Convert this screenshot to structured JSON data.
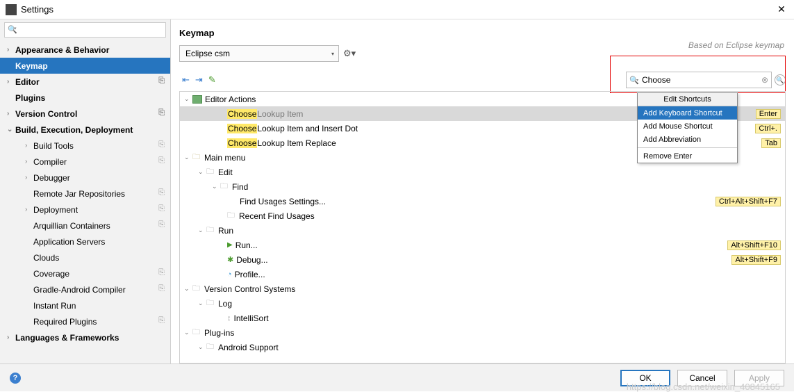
{
  "window": {
    "title": "Settings"
  },
  "sidebar_search": {
    "placeholder": ""
  },
  "sidebar": {
    "items": [
      {
        "label": "Appearance & Behavior",
        "bold": true,
        "chev": "›",
        "indent": 0
      },
      {
        "label": "Keymap",
        "bold": true,
        "selected": true,
        "indent": 0
      },
      {
        "label": "Editor",
        "bold": true,
        "chev": "›",
        "copy": true,
        "indent": 0
      },
      {
        "label": "Plugins",
        "bold": true,
        "indent": 0
      },
      {
        "label": "Version Control",
        "bold": true,
        "chev": "›",
        "copy": true,
        "indent": 0
      },
      {
        "label": "Build, Execution, Deployment",
        "bold": true,
        "chev": "⌄",
        "indent": 0
      },
      {
        "label": "Build Tools",
        "chev": "›",
        "copy": true,
        "indent": 1
      },
      {
        "label": "Compiler",
        "chev": "›",
        "copy": true,
        "indent": 1
      },
      {
        "label": "Debugger",
        "chev": "›",
        "indent": 1
      },
      {
        "label": "Remote Jar Repositories",
        "copy": true,
        "indent": 1
      },
      {
        "label": "Deployment",
        "chev": "›",
        "copy": true,
        "indent": 1
      },
      {
        "label": "Arquillian Containers",
        "copy": true,
        "indent": 1
      },
      {
        "label": "Application Servers",
        "indent": 1
      },
      {
        "label": "Clouds",
        "indent": 1
      },
      {
        "label": "Coverage",
        "copy": true,
        "indent": 1
      },
      {
        "label": "Gradle-Android Compiler",
        "copy": true,
        "indent": 1
      },
      {
        "label": "Instant Run",
        "indent": 1
      },
      {
        "label": "Required Plugins",
        "copy": true,
        "indent": 1
      },
      {
        "label": "Languages & Frameworks",
        "bold": true,
        "chev": "›",
        "indent": 0
      }
    ]
  },
  "content": {
    "heading": "Keymap",
    "keymap_name": "Eclipse csm",
    "based_on": "Based on Eclipse keymap",
    "search_value": "Choose"
  },
  "actions": {
    "root_label": "Editor Actions",
    "rows": [
      {
        "pre": "Choose",
        "post": " Lookup Item",
        "short": "Enter",
        "sel": true,
        "indent": 3
      },
      {
        "pre": "Choose",
        "post": " Lookup Item and Insert Dot",
        "short": "Ctrl+.",
        "indent": 3
      },
      {
        "pre": "Choose",
        "post": " Lookup Item Replace",
        "short": "Tab",
        "indent": 3
      }
    ],
    "main_menu": "Main menu",
    "edit": "Edit",
    "find": "Find",
    "find_usages": "Find Usages Settings...",
    "recent_find": "Recent Find Usages",
    "run_folder": "Run",
    "run": "Run...",
    "debug": "Debug...",
    "profile": "Profile...",
    "vcs": "Version Control Systems",
    "log": "Log",
    "intellisort": "IntelliSort",
    "plugins": "Plug-ins",
    "android": "Android Support",
    "shortcut_fus": "Ctrl+Alt+Shift+F7",
    "shortcut_run": "Alt+Shift+F10",
    "shortcut_debug": "Alt+Shift+F9"
  },
  "context": {
    "title": "Edit Shortcuts",
    "items": [
      "Add Keyboard Shortcut",
      "Add Mouse Shortcut",
      "Add Abbreviation"
    ],
    "remove": "Remove Enter"
  },
  "footer": {
    "ok": "OK",
    "cancel": "Cancel",
    "apply": "Apply"
  },
  "watermark": "https://blog.csdn.net/weixin_40845165"
}
